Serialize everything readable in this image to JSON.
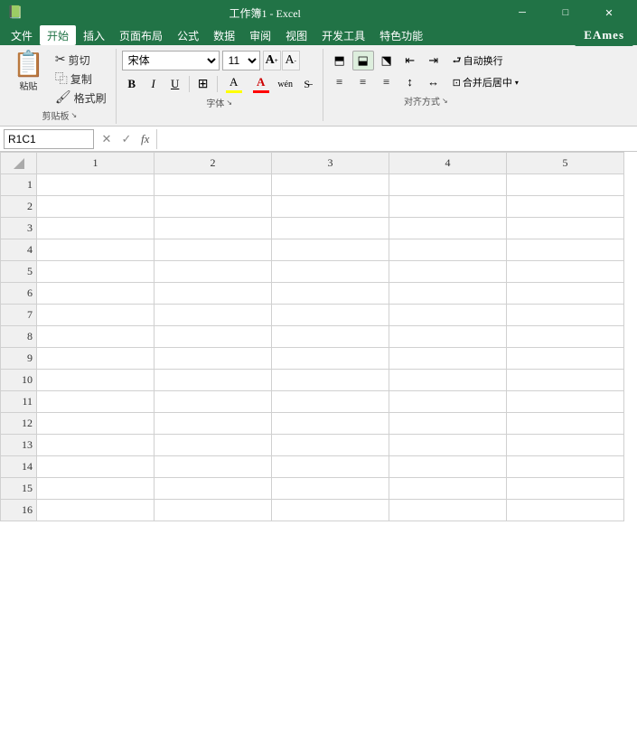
{
  "titlebar": {
    "title": "工作簿1 - Excel",
    "minimize_label": "─",
    "restore_label": "□",
    "close_label": "✕",
    "eames_label": "EAmes"
  },
  "menubar": {
    "items": [
      {
        "id": "file",
        "label": "文件"
      },
      {
        "id": "home",
        "label": "开始",
        "active": true
      },
      {
        "id": "insert",
        "label": "插入"
      },
      {
        "id": "layout",
        "label": "页面布局"
      },
      {
        "id": "formula",
        "label": "公式"
      },
      {
        "id": "data",
        "label": "数据"
      },
      {
        "id": "review",
        "label": "审阅"
      },
      {
        "id": "view",
        "label": "视图"
      },
      {
        "id": "developer",
        "label": "开发工具"
      },
      {
        "id": "special",
        "label": "特色功能"
      }
    ]
  },
  "ribbon": {
    "clipboard": {
      "label": "剪贴板",
      "paste_label": "粘贴",
      "cut_label": "剪切",
      "copy_label": "复制",
      "format_painter_label": "格式刷"
    },
    "font": {
      "label": "字体",
      "font_name": "宋体",
      "font_size": "11",
      "bold_label": "B",
      "italic_label": "I",
      "underline_label": "U",
      "border_label": "⊞",
      "fill_color_label": "A",
      "font_color_label": "A",
      "increase_font_label": "A",
      "decrease_font_label": "A"
    },
    "alignment": {
      "label": "对齐方式",
      "auto_wrap_label": "自动换行",
      "merge_center_label": "合并后居中"
    }
  },
  "formula_bar": {
    "cell_ref": "R1C1",
    "formula_placeholder": "",
    "cancel_label": "✕",
    "confirm_label": "✓",
    "fx_label": "fx"
  },
  "grid": {
    "columns": [
      "1",
      "2",
      "3",
      "4",
      "5"
    ],
    "rows": [
      "1",
      "2",
      "3",
      "4",
      "5",
      "6",
      "7",
      "8",
      "9",
      "10",
      "11",
      "12",
      "13",
      "14",
      "15",
      "16"
    ]
  }
}
